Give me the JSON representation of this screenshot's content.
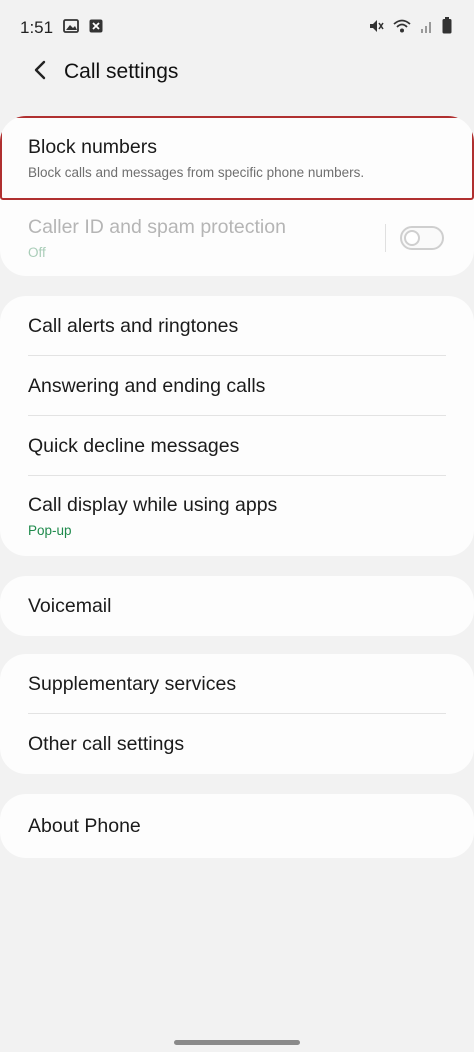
{
  "status": {
    "time": "1:51",
    "left_icons": [
      "gallery-icon",
      "close-box-icon"
    ],
    "right_icons": [
      "mute-icon",
      "wifi-icon",
      "signal-icon",
      "battery-icon"
    ]
  },
  "header": {
    "title": "Call settings",
    "back_icon": "chevron-left-icon"
  },
  "group1": {
    "block": {
      "title": "Block numbers",
      "subtitle": "Block calls and messages from specific phone numbers."
    },
    "caller_id": {
      "title": "Caller ID and spam protection",
      "subtitle": "Off",
      "toggle_on": false
    }
  },
  "group2": {
    "items": [
      {
        "title": "Call alerts and ringtones"
      },
      {
        "title": "Answering and ending calls"
      },
      {
        "title": "Quick decline messages"
      },
      {
        "title": "Call display while using apps",
        "subtitle": "Pop-up"
      }
    ]
  },
  "group3": {
    "voicemail": "Voicemail"
  },
  "group4": {
    "supplementary": "Supplementary services",
    "other": "Other call settings"
  },
  "group5": {
    "about": "About Phone"
  },
  "colors": {
    "highlight_border": "#b03030",
    "accent_green": "#1f8a4c",
    "background": "#f2f2f2"
  }
}
